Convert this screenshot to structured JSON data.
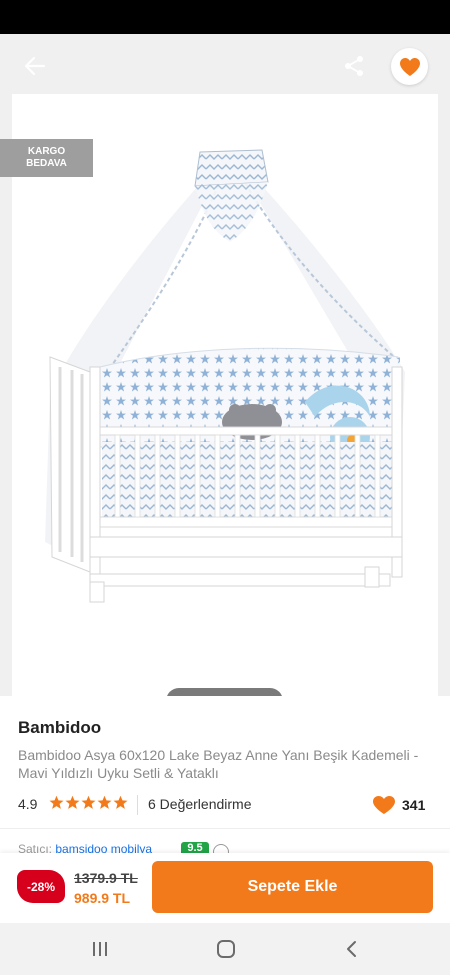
{
  "gallery": {
    "cargo_badge": [
      "KARGO",
      "BEDAVA"
    ],
    "image_count": 5,
    "active_image_index": 0,
    "back_icon": "arrow-left-icon",
    "share_icon": "share-icon",
    "favorite_icon": "heart-icon"
  },
  "product": {
    "brand": "Bambidoo",
    "title": "Bambidoo Asya 60x120 Lake Beyaz Anne Yanı Beşik Kademeli - Mavi Yıldızlı Uyku Setli & Yataklı",
    "rating": "4.9",
    "stars": 5,
    "review_count": "6 Değerlendirme",
    "like_count": "341"
  },
  "seller": {
    "label": "Satıcı:",
    "name": "bamsidoo mobilya",
    "score": "9.5"
  },
  "purchase": {
    "discount": "-28%",
    "old_price": "1379.9 TL",
    "new_price": "989.9 TL",
    "add_to_cart_label": "Sepete Ekle"
  },
  "colors": {
    "accent": "#f27a1a",
    "discount_red": "#d6001c",
    "seller_score_green": "#22a447",
    "star_orange": "#f27a1a"
  },
  "system_nav": {
    "recents_icon": "recents-icon",
    "home_icon": "home-icon",
    "back_icon": "chevron-left-icon"
  }
}
